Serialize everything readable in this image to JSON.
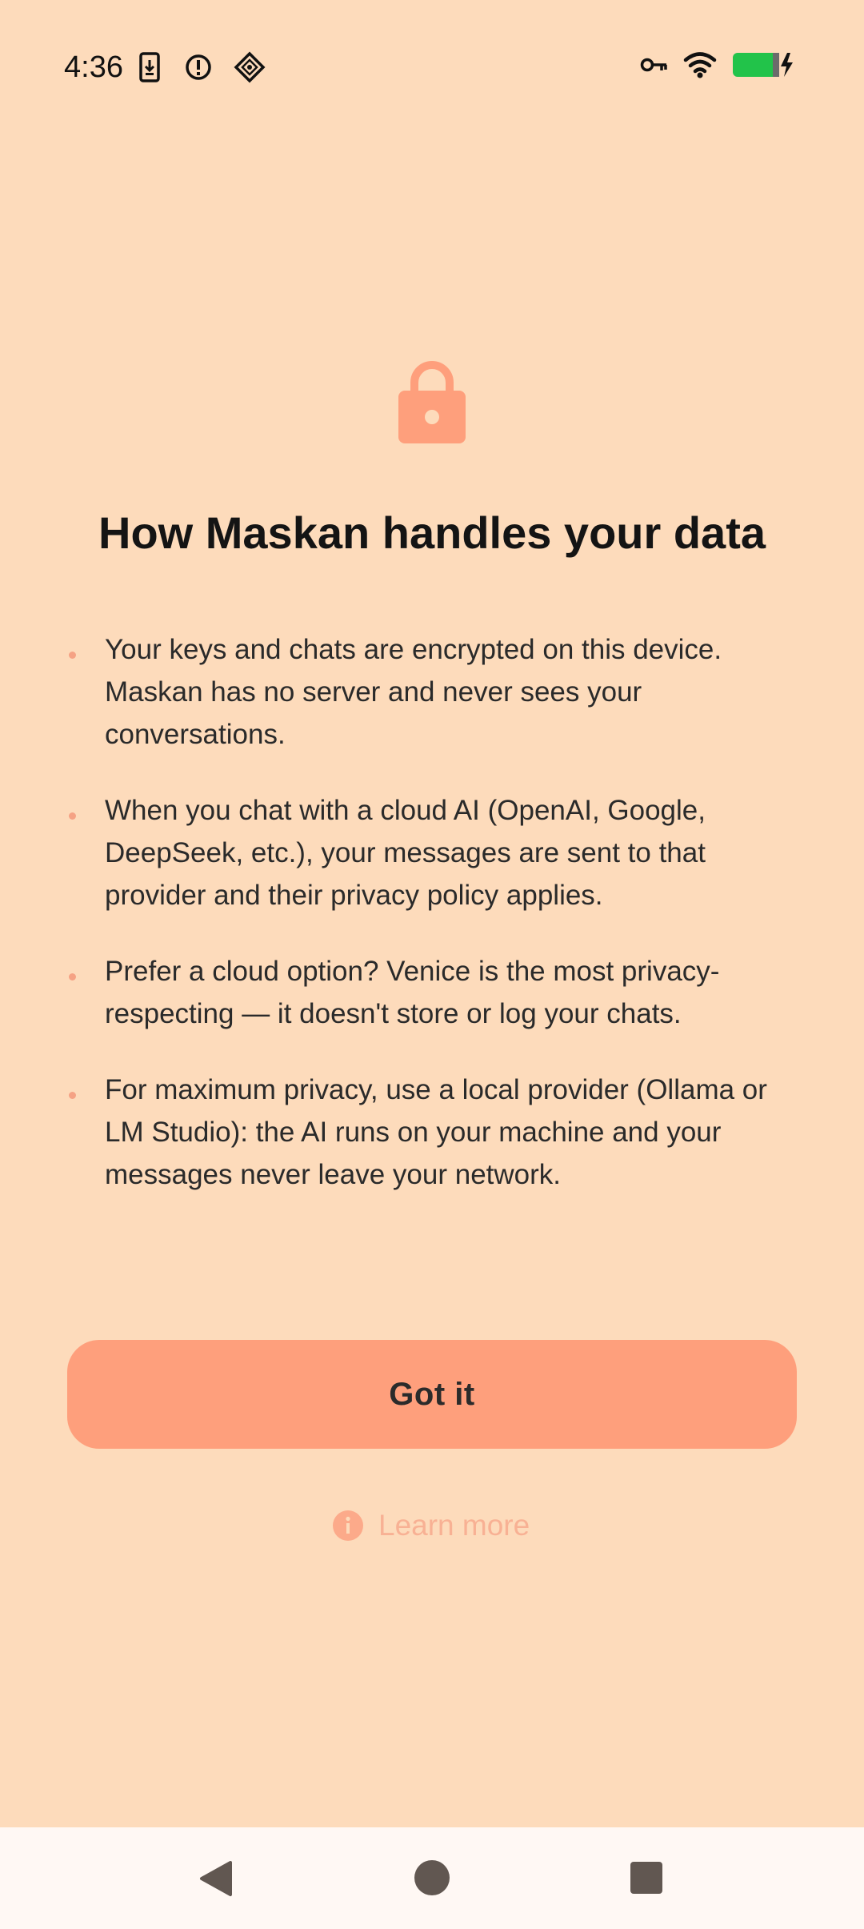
{
  "status_bar": {
    "time": "4:36",
    "left_icons": [
      "phone-download-icon",
      "alert-circle-icon",
      "shield-diamond-icon"
    ],
    "right_icons": [
      "vpn-key-icon",
      "wifi-icon",
      "battery-charging-icon"
    ],
    "battery_color": "#22C34A"
  },
  "main": {
    "icon": "lock-icon",
    "title": "How Maskan handles your data",
    "bullets": [
      "Your keys and chats are encrypted on this device. Maskan has no server and never sees your conversations.",
      "When you chat with a cloud AI (OpenAI, Google, DeepSeek, etc.), your messages are sent to that provider and their privacy policy applies.",
      "Prefer a cloud option? Venice is the most privacy-respecting — it doesn't store or log your chats.",
      "For maximum privacy, use a local provider (Ollama or LM Studio): the AI runs on your machine and your messages never leave your network."
    ],
    "primary_button": "Got it",
    "learn_more": "Learn more"
  },
  "nav_bar": {
    "items": [
      "back-icon",
      "home-icon",
      "recents-icon"
    ]
  },
  "colors": {
    "background": "#FDDBBB",
    "accent": "#FE9F7C",
    "learn_more": "#F8B194",
    "nav_bar": "#FFF8F4"
  }
}
